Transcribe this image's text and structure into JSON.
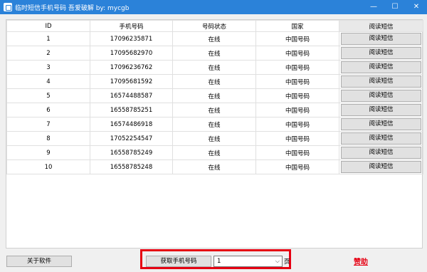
{
  "window": {
    "title": "临时短信手机号码 吾爱破解 by: mycgb",
    "minimize_glyph": "—",
    "maximize_glyph": "☐",
    "close_glyph": "✕",
    "icon": "app-icon"
  },
  "table": {
    "columns": [
      "ID",
      "手机号码",
      "号码状态",
      "国家",
      "阅读短信"
    ],
    "rows": [
      {
        "id": "1",
        "phone": "17096235871",
        "status": "在线",
        "country": "中国号码",
        "action": "阅读短信"
      },
      {
        "id": "2",
        "phone": "17095682970",
        "status": "在线",
        "country": "中国号码",
        "action": "阅读短信"
      },
      {
        "id": "3",
        "phone": "17096236762",
        "status": "在线",
        "country": "中国号码",
        "action": "阅读短信"
      },
      {
        "id": "4",
        "phone": "17095681592",
        "status": "在线",
        "country": "中国号码",
        "action": "阅读短信"
      },
      {
        "id": "5",
        "phone": "16574488587",
        "status": "在线",
        "country": "中国号码",
        "action": "阅读短信"
      },
      {
        "id": "6",
        "phone": "16558785251",
        "status": "在线",
        "country": "中国号码",
        "action": "阅读短信"
      },
      {
        "id": "7",
        "phone": "16574486918",
        "status": "在线",
        "country": "中国号码",
        "action": "阅读短信"
      },
      {
        "id": "8",
        "phone": "17052254547",
        "status": "在线",
        "country": "中国号码",
        "action": "阅读短信"
      },
      {
        "id": "9",
        "phone": "16558785249",
        "status": "在线",
        "country": "中国号码",
        "action": "阅读短信"
      },
      {
        "id": "10",
        "phone": "16558785248",
        "status": "在线",
        "country": "中国号码",
        "action": "阅读短信"
      }
    ]
  },
  "footer": {
    "about_label": "关于软件",
    "get_numbers_label": "获取手机号码",
    "page_value": "1",
    "page_unit": "页",
    "donate_label": "赞助"
  },
  "colors": {
    "titlebar": "#2b82d9",
    "highlight_border": "#e60012",
    "donate_text": "#e60012"
  }
}
